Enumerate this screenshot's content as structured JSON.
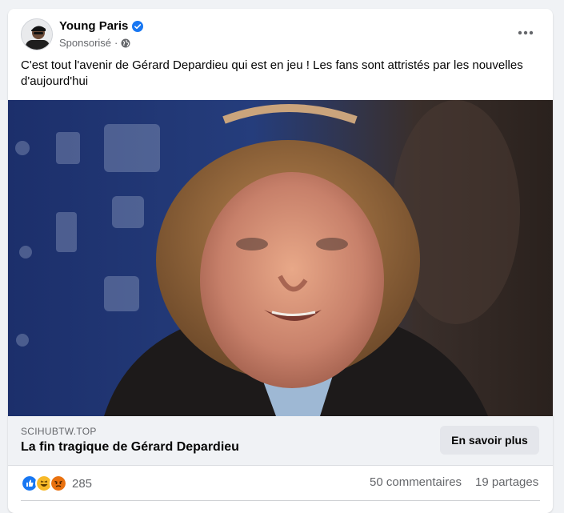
{
  "post": {
    "author": "Young Paris",
    "sponsored": "Sponsorisé",
    "separator": "·",
    "text": "C'est tout l'avenir de Gérard Depardieu qui est en jeu ! Les fans sont attristés par les nouvelles d'aujourd'hui",
    "icons": {
      "verified": "verified-badge-icon",
      "audience": "globe-icon",
      "more": "more-options-icon"
    }
  },
  "link": {
    "domain": "SCIHUBTW.TOP",
    "title": "La fin tragique de Gérard Depardieu",
    "cta_label": "En savoir plus"
  },
  "stats": {
    "reactions_count": "285",
    "comments": "50 commentaires",
    "shares": "19 partages",
    "reaction_icons": [
      "like-icon",
      "haha-icon",
      "angry-icon"
    ]
  },
  "colors": {
    "accent": "#1877f2",
    "card_bg": "#ffffff",
    "page_bg": "#f0f2f5",
    "secondary_text": "#65676b"
  }
}
